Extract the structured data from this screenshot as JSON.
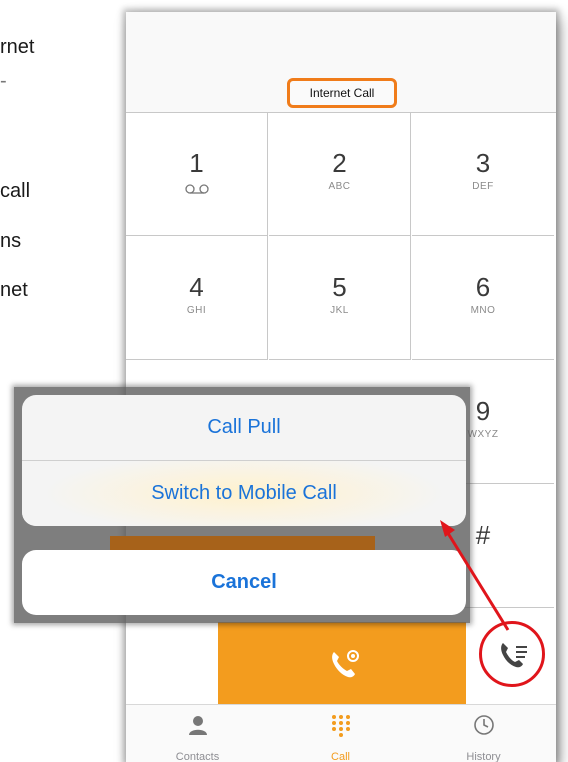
{
  "document": {
    "lines": [
      "rnet",
      "-",
      "call",
      "ns",
      "net"
    ]
  },
  "phone": {
    "mode_label": "Internet Call",
    "keys": [
      {
        "digit": "1",
        "letters": ""
      },
      {
        "digit": "2",
        "letters": "ABC"
      },
      {
        "digit": "3",
        "letters": "DEF"
      },
      {
        "digit": "4",
        "letters": "GHI"
      },
      {
        "digit": "5",
        "letters": "JKL"
      },
      {
        "digit": "6",
        "letters": "MNO"
      },
      {
        "digit": "9",
        "letters": "WXYZ"
      },
      {
        "digit": "#",
        "letters": ""
      }
    ],
    "tabs": [
      {
        "label": "Contacts",
        "icon": "person-icon"
      },
      {
        "label": "Call",
        "icon": "keypad-icon"
      },
      {
        "label": "History",
        "icon": "history-icon"
      }
    ],
    "accent_color": "#f39c1e"
  },
  "action_sheet": {
    "call_pull": "Call Pull",
    "switch_mobile": "Switch to Mobile Call",
    "cancel": "Cancel",
    "text_color": "#1a73d9"
  },
  "annotation_color": "#e0151b"
}
